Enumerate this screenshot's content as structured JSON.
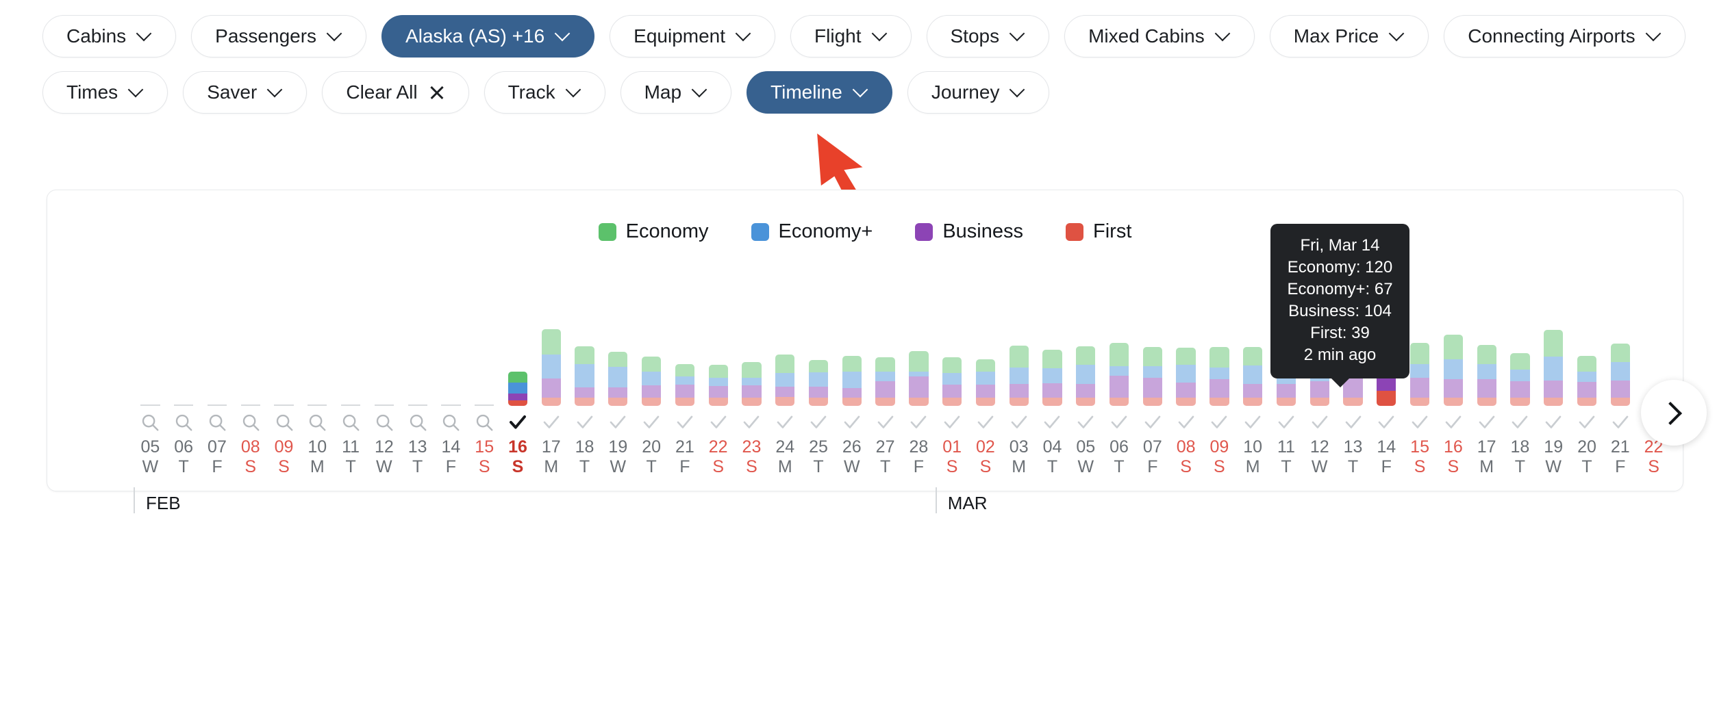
{
  "toolbar": {
    "row1": [
      {
        "label": "Cabins",
        "icon": "chevron-down-icon",
        "active": false
      },
      {
        "label": "Passengers",
        "icon": "chevron-down-icon",
        "active": false
      },
      {
        "label": "Alaska (AS) +16",
        "icon": "chevron-down-icon",
        "active": true
      },
      {
        "label": "Equipment",
        "icon": "chevron-down-icon",
        "active": false
      },
      {
        "label": "Flight",
        "icon": "chevron-down-icon",
        "active": false
      },
      {
        "label": "Stops",
        "icon": "chevron-down-icon",
        "active": false
      },
      {
        "label": "Mixed Cabins",
        "icon": "chevron-down-icon",
        "active": false
      },
      {
        "label": "Max Price",
        "icon": "chevron-down-icon",
        "active": false
      },
      {
        "label": "Connecting Airports",
        "icon": "chevron-down-icon",
        "active": false
      }
    ],
    "row2": [
      {
        "label": "Times",
        "icon": "chevron-down-icon",
        "active": false
      },
      {
        "label": "Saver",
        "icon": "chevron-down-icon",
        "active": false
      },
      {
        "label": "Clear All",
        "icon": "close-icon",
        "active": false
      },
      {
        "label": "Track",
        "icon": "chevron-down-icon",
        "active": false
      },
      {
        "label": "Map",
        "icon": "chevron-down-icon",
        "active": false
      },
      {
        "label": "Timeline",
        "icon": "chevron-down-icon",
        "active": true
      },
      {
        "label": "Journey",
        "icon": "chevron-down-icon",
        "active": false
      }
    ]
  },
  "annotation": {
    "pointer": "red-arrow-cursor",
    "points_at": "Timeline",
    "color": "#e8412a"
  },
  "legend": [
    {
      "label": "Economy",
      "color": "#5cc16b"
    },
    {
      "label": "Economy+",
      "color": "#4a93d9"
    },
    {
      "label": "Business",
      "color": "#8c44b5"
    },
    {
      "label": "First",
      "color": "#df5242"
    }
  ],
  "tooltip": {
    "date": "Fri, Mar 14",
    "lines": [
      "Economy: 120",
      "Economy+: 67",
      "Business: 104",
      "First: 39"
    ],
    "economy": "Economy: 120",
    "economy_plus": "Economy+: 67",
    "business": "Business: 104",
    "first": "First: 39",
    "updated": "2 min ago"
  },
  "months": [
    {
      "label": "FEB",
      "index": 0
    },
    {
      "label": "MAR",
      "index": 24
    }
  ],
  "next_button": {
    "icon": "chevron-right-icon",
    "label": ""
  },
  "chart_data": {
    "type": "bar",
    "stacked": true,
    "title": "",
    "xlabel": "",
    "ylabel": "",
    "grid": false,
    "legend_position": "top-center",
    "series": [
      {
        "name": "Economy",
        "color": "#5cc16b"
      },
      {
        "name": "Economy+",
        "color": "#4a93d9"
      },
      {
        "name": "Business",
        "color": "#8c44b5"
      },
      {
        "name": "First",
        "color": "#df5242"
      }
    ],
    "selected_index": 11,
    "hovered_index": 37,
    "points": [
      {
        "day": "05",
        "dow": "W",
        "month": "FEB",
        "weekend": false,
        "icon": "search-icon",
        "values": [
          0,
          0,
          0,
          0
        ]
      },
      {
        "day": "06",
        "dow": "T",
        "month": "FEB",
        "weekend": false,
        "icon": "search-icon",
        "values": [
          0,
          0,
          0,
          0
        ]
      },
      {
        "day": "07",
        "dow": "F",
        "month": "FEB",
        "weekend": false,
        "icon": "search-icon",
        "values": [
          0,
          0,
          0,
          0
        ]
      },
      {
        "day": "08",
        "dow": "S",
        "month": "FEB",
        "weekend": true,
        "icon": "search-icon",
        "values": [
          0,
          0,
          0,
          0
        ]
      },
      {
        "day": "09",
        "dow": "S",
        "month": "FEB",
        "weekend": true,
        "icon": "search-icon",
        "values": [
          0,
          0,
          0,
          0
        ]
      },
      {
        "day": "10",
        "dow": "M",
        "month": "FEB",
        "weekend": false,
        "icon": "search-icon",
        "values": [
          0,
          0,
          0,
          0
        ]
      },
      {
        "day": "11",
        "dow": "T",
        "month": "FEB",
        "weekend": false,
        "icon": "search-icon",
        "values": [
          0,
          0,
          0,
          0
        ]
      },
      {
        "day": "12",
        "dow": "W",
        "month": "FEB",
        "weekend": false,
        "icon": "search-icon",
        "values": [
          0,
          0,
          0,
          0
        ]
      },
      {
        "day": "13",
        "dow": "T",
        "month": "FEB",
        "weekend": false,
        "icon": "search-icon",
        "values": [
          0,
          0,
          0,
          0
        ]
      },
      {
        "day": "14",
        "dow": "F",
        "month": "FEB",
        "weekend": false,
        "icon": "search-icon",
        "values": [
          0,
          0,
          0,
          0
        ]
      },
      {
        "day": "15",
        "dow": "S",
        "month": "FEB",
        "weekend": true,
        "icon": "search-icon",
        "values": [
          0,
          0,
          0,
          0
        ]
      },
      {
        "day": "16",
        "dow": "S",
        "month": "FEB",
        "weekend": true,
        "icon": "check-icon-selected",
        "values": [
          30,
          28,
          18,
          14
        ]
      },
      {
        "day": "17",
        "dow": "M",
        "month": "FEB",
        "weekend": false,
        "icon": "check-icon",
        "values": [
          66,
          63,
          49,
          22
        ]
      },
      {
        "day": "18",
        "dow": "T",
        "month": "FEB",
        "weekend": false,
        "icon": "check-icon",
        "values": [
          47,
          60,
          28,
          21
        ]
      },
      {
        "day": "19",
        "dow": "W",
        "month": "FEB",
        "weekend": false,
        "icon": "check-icon",
        "values": [
          39,
          54,
          27,
          21
        ]
      },
      {
        "day": "20",
        "dow": "T",
        "month": "FEB",
        "weekend": false,
        "icon": "check-icon",
        "values": [
          38,
          36,
          32,
          22
        ]
      },
      {
        "day": "21",
        "dow": "F",
        "month": "FEB",
        "weekend": false,
        "icon": "check-icon",
        "values": [
          33,
          21,
          33,
          22
        ]
      },
      {
        "day": "22",
        "dow": "S",
        "month": "FEB",
        "weekend": true,
        "icon": "check-icon",
        "values": [
          34,
          22,
          29,
          22
        ]
      },
      {
        "day": "23",
        "dow": "S",
        "month": "FEB",
        "weekend": true,
        "icon": "check-icon",
        "values": [
          40,
          21,
          31,
          22
        ]
      },
      {
        "day": "24",
        "dow": "M",
        "month": "FEB",
        "weekend": false,
        "icon": "check-icon",
        "values": [
          48,
          35,
          27,
          23
        ]
      },
      {
        "day": "25",
        "dow": "T",
        "month": "FEB",
        "weekend": false,
        "icon": "check-icon",
        "values": [
          32,
          37,
          28,
          22
        ]
      },
      {
        "day": "26",
        "dow": "W",
        "month": "FEB",
        "weekend": false,
        "icon": "check-icon",
        "values": [
          40,
          43,
          25,
          22
        ]
      },
      {
        "day": "27",
        "dow": "T",
        "month": "FEB",
        "weekend": false,
        "icon": "check-icon",
        "values": [
          37,
          25,
          42,
          22
        ]
      },
      {
        "day": "28",
        "dow": "F",
        "month": "FEB",
        "weekend": false,
        "icon": "check-icon",
        "values": [
          53,
          13,
          55,
          22
        ]
      },
      {
        "day": "01",
        "dow": "S",
        "month": "MAR",
        "weekend": true,
        "icon": "check-icon",
        "values": [
          41,
          31,
          33,
          22
        ]
      },
      {
        "day": "02",
        "dow": "S",
        "month": "MAR",
        "weekend": true,
        "icon": "check-icon",
        "values": [
          32,
          34,
          34,
          22
        ]
      },
      {
        "day": "03",
        "dow": "M",
        "month": "MAR",
        "weekend": false,
        "icon": "check-icon",
        "values": [
          57,
          43,
          35,
          22
        ]
      },
      {
        "day": "04",
        "dow": "T",
        "month": "MAR",
        "weekend": false,
        "icon": "check-icon",
        "values": [
          47,
          40,
          37,
          22
        ]
      },
      {
        "day": "05",
        "dow": "W",
        "month": "MAR",
        "weekend": false,
        "icon": "check-icon",
        "values": [
          48,
          50,
          35,
          22
        ]
      },
      {
        "day": "06",
        "dow": "T",
        "month": "MAR",
        "weekend": false,
        "icon": "check-icon",
        "values": [
          62,
          24,
          57,
          22
        ]
      },
      {
        "day": "07",
        "dow": "F",
        "month": "MAR",
        "weekend": false,
        "icon": "check-icon",
        "values": [
          50,
          30,
          51,
          22
        ]
      },
      {
        "day": "08",
        "dow": "S",
        "month": "MAR",
        "weekend": true,
        "icon": "check-icon",
        "values": [
          44,
          47,
          38,
          22
        ]
      },
      {
        "day": "09",
        "dow": "S",
        "month": "MAR",
        "weekend": true,
        "icon": "check-icon",
        "values": [
          53,
          31,
          47,
          22
        ]
      },
      {
        "day": "10",
        "dow": "M",
        "month": "MAR",
        "weekend": false,
        "icon": "check-icon",
        "values": [
          47,
          49,
          35,
          22
        ]
      },
      {
        "day": "11",
        "dow": "T",
        "month": "MAR",
        "weekend": false,
        "icon": "check-icon",
        "values": [
          54,
          47,
          36,
          22
        ]
      },
      {
        "day": "12",
        "dow": "W",
        "month": "MAR",
        "weekend": false,
        "icon": "check-icon",
        "values": [
          45,
          40,
          42,
          22
        ]
      },
      {
        "day": "13",
        "dow": "T",
        "month": "MAR",
        "weekend": false,
        "icon": "check-icon",
        "values": [
          49,
          30,
          51,
          22
        ]
      },
      {
        "day": "14",
        "dow": "F",
        "month": "MAR",
        "weekend": false,
        "icon": "check-icon",
        "values": [
          120,
          67,
          104,
          39
        ]
      },
      {
        "day": "15",
        "dow": "S",
        "month": "MAR",
        "weekend": true,
        "icon": "check-icon",
        "values": [
          55,
          35,
          52,
          22
        ]
      },
      {
        "day": "16",
        "dow": "S",
        "month": "MAR",
        "weekend": true,
        "icon": "check-icon",
        "values": [
          63,
          52,
          48,
          22
        ]
      },
      {
        "day": "17",
        "dow": "M",
        "month": "MAR",
        "weekend": false,
        "icon": "check-icon",
        "values": [
          50,
          38,
          48,
          22
        ]
      },
      {
        "day": "18",
        "dow": "T",
        "month": "MAR",
        "weekend": false,
        "icon": "check-icon",
        "values": [
          43,
          31,
          42,
          22
        ]
      },
      {
        "day": "19",
        "dow": "W",
        "month": "MAR",
        "weekend": false,
        "icon": "check-icon",
        "values": [
          69,
          63,
          44,
          22
        ]
      },
      {
        "day": "20",
        "dow": "T",
        "month": "MAR",
        "weekend": false,
        "icon": "check-icon",
        "values": [
          40,
          28,
          40,
          22
        ]
      },
      {
        "day": "21",
        "dow": "F",
        "month": "MAR",
        "weekend": false,
        "icon": "check-icon",
        "values": [
          49,
          48,
          44,
          22
        ]
      },
      {
        "day": "22",
        "dow": "S",
        "month": "MAR",
        "weekend": true,
        "icon": "search-icon",
        "values": [
          0,
          0,
          0,
          0
        ]
      }
    ]
  }
}
